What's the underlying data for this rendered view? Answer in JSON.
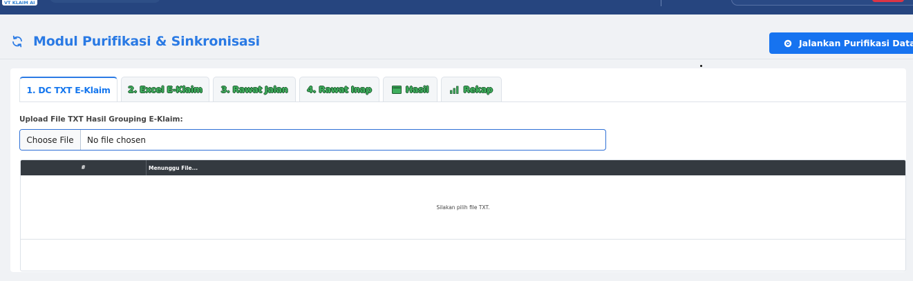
{
  "topbar": {
    "logo_main": "VT KLAIM",
    "logo_suffix": "AI"
  },
  "header": {
    "title": "Modul Purifikasi & Sinkronisasi",
    "run_button": "Jalankan Purifikasi Data"
  },
  "tabs": [
    {
      "label": "1. DC TXT E-Klaim",
      "active": true
    },
    {
      "label": "2. Excel E-Klaim"
    },
    {
      "label": "3. Rawat Jalan"
    },
    {
      "label": "4. Rawat Inap"
    },
    {
      "label": "Hasil",
      "icon": "table-icon"
    },
    {
      "label": "Rekap",
      "icon": "bar-chart-icon"
    }
  ],
  "upload": {
    "label": "Upload File TXT Hasil Grouping E-Klaim:",
    "choose_button": "Choose File",
    "status": "No file chosen"
  },
  "table": {
    "col_num": "#",
    "col_file": "Menunggu File...",
    "empty_message": "Silakan pilih file TXT."
  },
  "colors": {
    "primary": "#1673f0",
    "title": "#2a7ae4",
    "tab_green": "#3fae5d",
    "topbar": "#26457f",
    "table_head": "#343a40"
  }
}
